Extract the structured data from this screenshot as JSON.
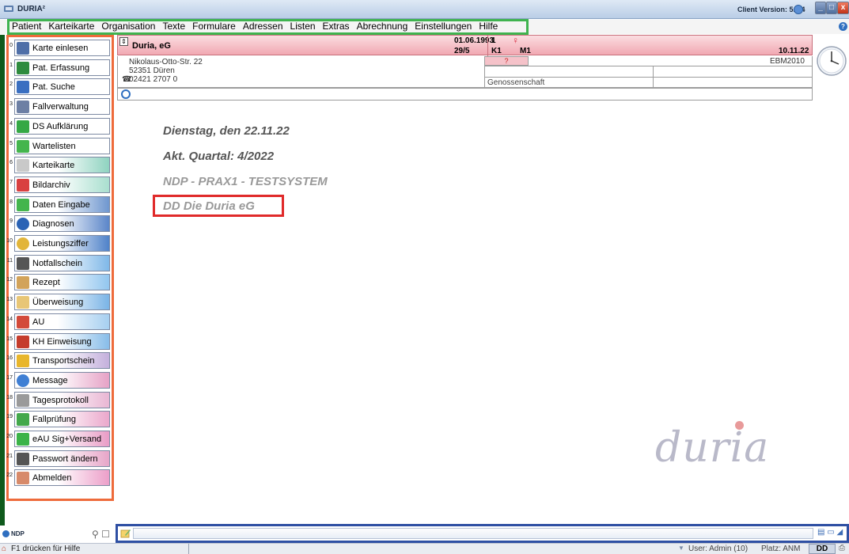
{
  "window": {
    "title": "DURIA²",
    "client_version": "Client Version: 5.9.4"
  },
  "menu": [
    "Patient",
    "Karteikarte",
    "Organisation",
    "Texte",
    "Formulare",
    "Adressen",
    "Listen",
    "Extras",
    "Abrechnung",
    "Einstellungen",
    "Hilfe"
  ],
  "sidebar": {
    "items": [
      {
        "num": "0",
        "label": "Karte einlesen",
        "icon": "card-reader-icon",
        "color": "#ffffff"
      },
      {
        "num": "1",
        "label": "Pat. Erfassung",
        "icon": "add-patient-icon",
        "color": "#ffffff"
      },
      {
        "num": "2",
        "label": "Pat. Suche",
        "icon": "magnifier-icon",
        "color": "#ffffff"
      },
      {
        "num": "3",
        "label": "Fallverwaltung",
        "icon": "case-icon",
        "color": "#ffffff"
      },
      {
        "num": "4",
        "label": "DS Aufklärung",
        "icon": "green-arrow-icon",
        "color": "#ffffff"
      },
      {
        "num": "5",
        "label": "Wartelisten",
        "icon": "green-plus-icon",
        "color": "#ffffff"
      },
      {
        "num": "6",
        "label": "Karteikarte",
        "icon": "index-card-icon",
        "color": "#8fd3c0"
      },
      {
        "num": "7",
        "label": "Bildarchiv",
        "icon": "image-archive-icon",
        "color": "#a9dfcf"
      },
      {
        "num": "8",
        "label": "Daten Eingabe",
        "icon": "green-plus-icon",
        "color": "#6f97cf"
      },
      {
        "num": "9",
        "label": "Diagnosen",
        "icon": "diagnosis-d-icon",
        "color": "#5b86c9"
      },
      {
        "num": "10",
        "label": "Leistungsziffer",
        "icon": "coin-icon",
        "color": "#4f82c9"
      },
      {
        "num": "11",
        "label": "Notfallschein",
        "icon": "pen-icon",
        "color": "#7fb8e8"
      },
      {
        "num": "12",
        "label": "Rezept",
        "icon": "pencil-icon",
        "color": "#92c6ef"
      },
      {
        "num": "13",
        "label": "Überweisung",
        "icon": "notebook-icon",
        "color": "#7ab4e6"
      },
      {
        "num": "14",
        "label": "AU",
        "icon": "house-icon",
        "color": "#a6cff0"
      },
      {
        "num": "15",
        "label": "KH Einweisung",
        "icon": "hospital-icon",
        "color": "#88bde9"
      },
      {
        "num": "16",
        "label": "Transportschein",
        "icon": "taxi-icon",
        "color": "#c4b0dc"
      },
      {
        "num": "17",
        "label": "Message",
        "icon": "message-icon",
        "color": "#e6a2c6"
      },
      {
        "num": "18",
        "label": "Tagesprotokoll",
        "icon": "protocol-icon",
        "color": "#e9b6d3"
      },
      {
        "num": "19",
        "label": "Fallprüfung",
        "icon": "thumbs-up-icon",
        "color": "#eba7cb"
      },
      {
        "num": "20",
        "label": "eAU Sig+Versand",
        "icon": "refresh-icon",
        "color": "#e99cc6"
      },
      {
        "num": "21",
        "label": "Passwort ändern",
        "icon": "user-key-icon",
        "color": "#e7a5c8"
      },
      {
        "num": "22",
        "label": "Abmelden",
        "icon": "users-logout-icon",
        "color": "#ec9fc9"
      }
    ],
    "footer_logo": "NDP"
  },
  "patient": {
    "name": "Duria, eG",
    "birth_date": "01.06.1993",
    "sub_number": "29/5",
    "number": "1",
    "gender_symbol": "♀",
    "k_code": "K1",
    "m_code": "M1",
    "date": "10.11.22",
    "street": "Nikolaus-Otto-Str. 22",
    "city": "52351 Düren",
    "phone": "02421 2707 0",
    "question_mark": "?",
    "ebm": "EBM2010",
    "type": "Genossenschaft"
  },
  "main": {
    "date_line": "Dienstag, den 22.11.22",
    "quarter_line": "Akt. Quartal: 4/2022",
    "system_line": "NDP - PRAX1 - TESTSYSTEM",
    "company_line": "DD Die Duria eG",
    "watermark": "duria"
  },
  "command_input": {
    "value": ""
  },
  "statusbar": {
    "help": "F1 drücken für Hilfe",
    "user": "User: Admin (10)",
    "place": "Platz: ANM",
    "dd": "DD"
  },
  "colors": {
    "menu_highlight": "#3fb34f",
    "sidebar_border": "#ee6b3b",
    "company_highlight": "#e02a2a",
    "input_border": "#2e4fa3",
    "patient_header": "#f1a8b2"
  }
}
